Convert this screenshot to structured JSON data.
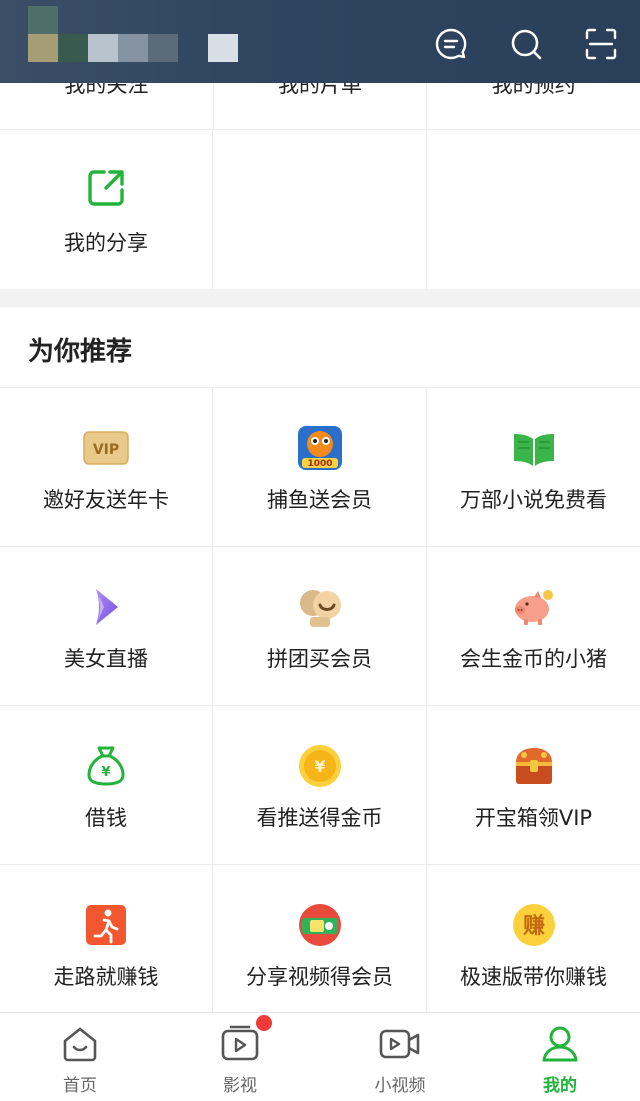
{
  "header": {
    "icons": [
      "message-icon",
      "search-icon",
      "scan-icon"
    ]
  },
  "my_section": {
    "cut_items": [
      "我的关注",
      "我的片单",
      "我的预约"
    ],
    "share": {
      "label": "我的分享",
      "icon": "share-icon"
    }
  },
  "recommend": {
    "title": "为你推荐",
    "items": [
      {
        "label": "邀好友送年卡",
        "icon": "vip-card-icon"
      },
      {
        "label": "捕鱼送会员",
        "icon": "fish-game-icon"
      },
      {
        "label": "万部小说免费看",
        "icon": "book-icon"
      },
      {
        "label": "美女直播",
        "icon": "live-play-icon"
      },
      {
        "label": "拼团买会员",
        "icon": "group-buy-icon"
      },
      {
        "label": "会生金币的小猪",
        "icon": "piggy-icon"
      },
      {
        "label": "借钱",
        "icon": "money-bag-icon"
      },
      {
        "label": "看推送得金币",
        "icon": "gold-coin-icon"
      },
      {
        "label": "开宝箱领VIP",
        "icon": "treasure-chest-icon"
      },
      {
        "label": "走路就赚钱",
        "icon": "walk-icon"
      },
      {
        "label": "分享视频得会员",
        "icon": "share-video-icon"
      },
      {
        "label": "极速版带你赚钱",
        "icon": "earn-coin-icon"
      }
    ]
  },
  "tabbar": {
    "tabs": [
      {
        "label": "首页",
        "icon": "home-icon"
      },
      {
        "label": "影视",
        "icon": "video-play-icon"
      },
      {
        "label": "小视频",
        "icon": "video-camera-icon"
      },
      {
        "label": "我的",
        "icon": "user-icon"
      }
    ],
    "active_color": "#22b33a"
  }
}
